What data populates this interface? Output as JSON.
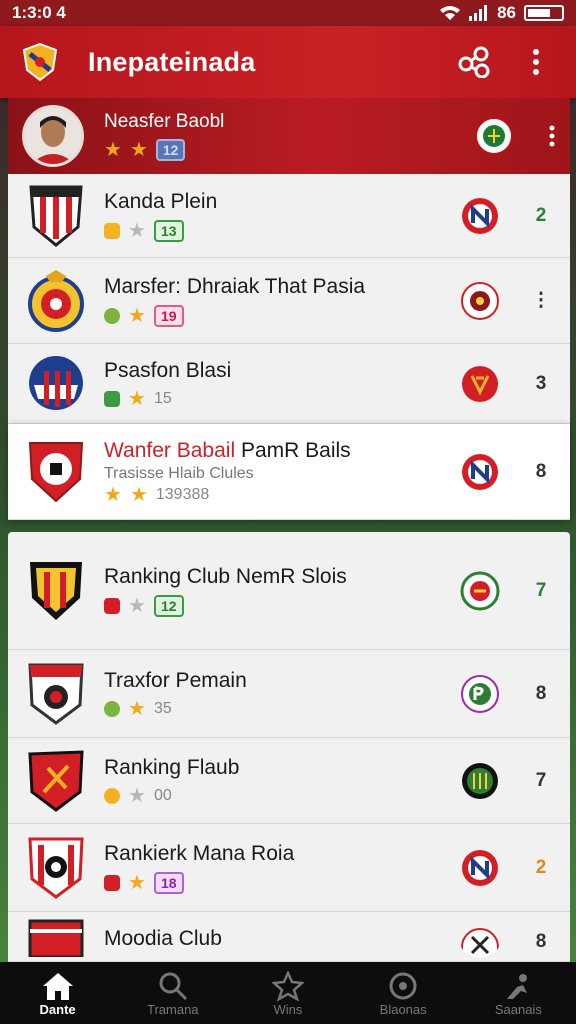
{
  "status_bar": {
    "time": "1:3:0 4",
    "signal_text": "86"
  },
  "app_bar": {
    "title": "Inepateinada"
  },
  "featured": {
    "name": "Neasfer Baobl",
    "stars": 2,
    "count": "12"
  },
  "rows": [
    {
      "name": "Kanda Plein",
      "stars_on": 1,
      "stars_off": 1,
      "count": "13",
      "rank": "2",
      "rank_color": "#2e7d32"
    },
    {
      "name": "Marsfer: Dhraiak That Pasia",
      "stars_on": 1,
      "stars_off": 0,
      "count": "19",
      "rank": "⋮",
      "rank_color": "#333333"
    },
    {
      "name": "Psasfon Blasi",
      "stars_on": 1,
      "stars_off": 0,
      "count": "15",
      "rank": "3",
      "rank_color": "#333333"
    },
    {
      "name_red": "Wanfer Babail",
      "name_rest": " PamR Bails",
      "sub": "Trasisse Hlaib Clules",
      "stars_on": 2,
      "count": "139388",
      "rank": "8",
      "rank_color": "#333333"
    },
    {
      "name": "Ranking  Club NemR Slois",
      "stars_on": 0,
      "stars_off": 1,
      "count": "12",
      "rank": "7",
      "rank_color": "#2e7d32"
    },
    {
      "name": "Traxfor Pemain",
      "stars_on": 1,
      "stars_off": 0,
      "count": "35",
      "rank": "8",
      "rank_color": "#333333"
    },
    {
      "name": "Ranking Flaub",
      "stars_on": 0,
      "stars_off": 1,
      "count": "00",
      "rank": "7",
      "rank_color": "#333333"
    },
    {
      "name": "Rankierk Mana Roia",
      "stars_on": 1,
      "stars_off": 0,
      "count": "18",
      "rank": "2",
      "rank_color": "#e08a1c"
    },
    {
      "name": "Moodia Club",
      "rank": "8",
      "rank_color": "#333333"
    }
  ],
  "bottom_nav": [
    {
      "label": "Dante",
      "icon": "home-icon",
      "active": true
    },
    {
      "label": "Tramana",
      "icon": "search-icon",
      "active": false
    },
    {
      "label": "Wins",
      "icon": "star-badge-icon",
      "active": false
    },
    {
      "label": "Blaonas",
      "icon": "ball-icon",
      "active": false
    },
    {
      "label": "Saanais",
      "icon": "player-icon",
      "active": false
    }
  ],
  "colors": {
    "primary": "#c92126",
    "accent_star": "#f1a81b",
    "nav_bg": "#0d0d0d"
  }
}
